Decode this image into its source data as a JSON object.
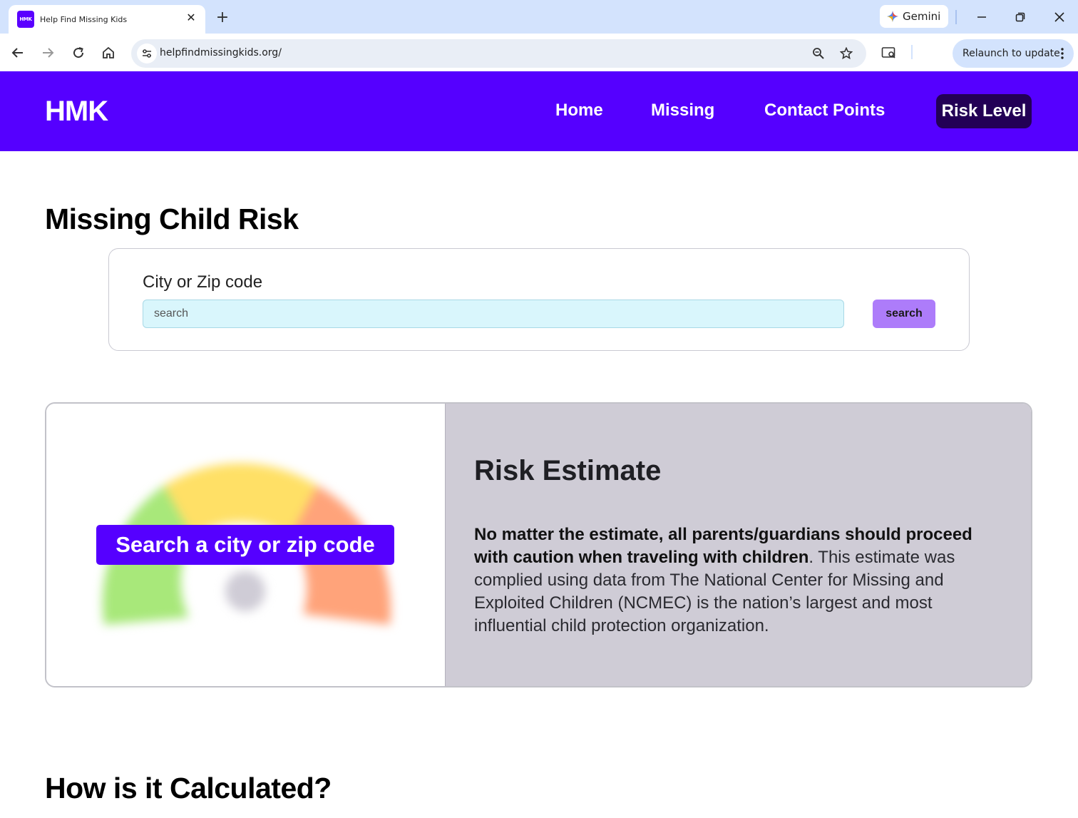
{
  "browser": {
    "tab_title": "Help Find Missing Kids",
    "tab_favicon_text": "HMK",
    "tab_close": "✕",
    "new_tab": "+",
    "gemini_label": "Gemini",
    "url": "helpfindmissingkids.org/",
    "relaunch_label": "Relaunch to update"
  },
  "header": {
    "logo": "HMK",
    "nav": [
      {
        "label": "Home"
      },
      {
        "label": "Missing"
      },
      {
        "label": "Contact Points"
      },
      {
        "label": "Risk Level"
      }
    ]
  },
  "main": {
    "title": "Missing Child Risk",
    "search": {
      "label": "City or Zip code",
      "placeholder": "search",
      "value": "",
      "button_label": "search"
    },
    "risk_card": {
      "gauge_cta": "Search a city or zip code",
      "gauge_colors": [
        "#a8e87a",
        "#ffe066",
        "#ffa37a",
        "#cfccd6"
      ],
      "title": "Risk Estimate",
      "bold_text": "No matter the estimate, all parents/guardians should proceed with caution when traveling with children",
      "body_text": ". This estimate was complied using data from The National Center for Missing and Exploited Children (NCMEC) is the nation’s largest and most influential child protection organization."
    },
    "section_title": "How is it Calculated?"
  },
  "colors": {
    "brand": "#5500ff",
    "nav_active": "#230056",
    "search_button": "#ad7cfa",
    "input_bg": "#d9f6fc",
    "info_panel": "#cfccd6"
  }
}
